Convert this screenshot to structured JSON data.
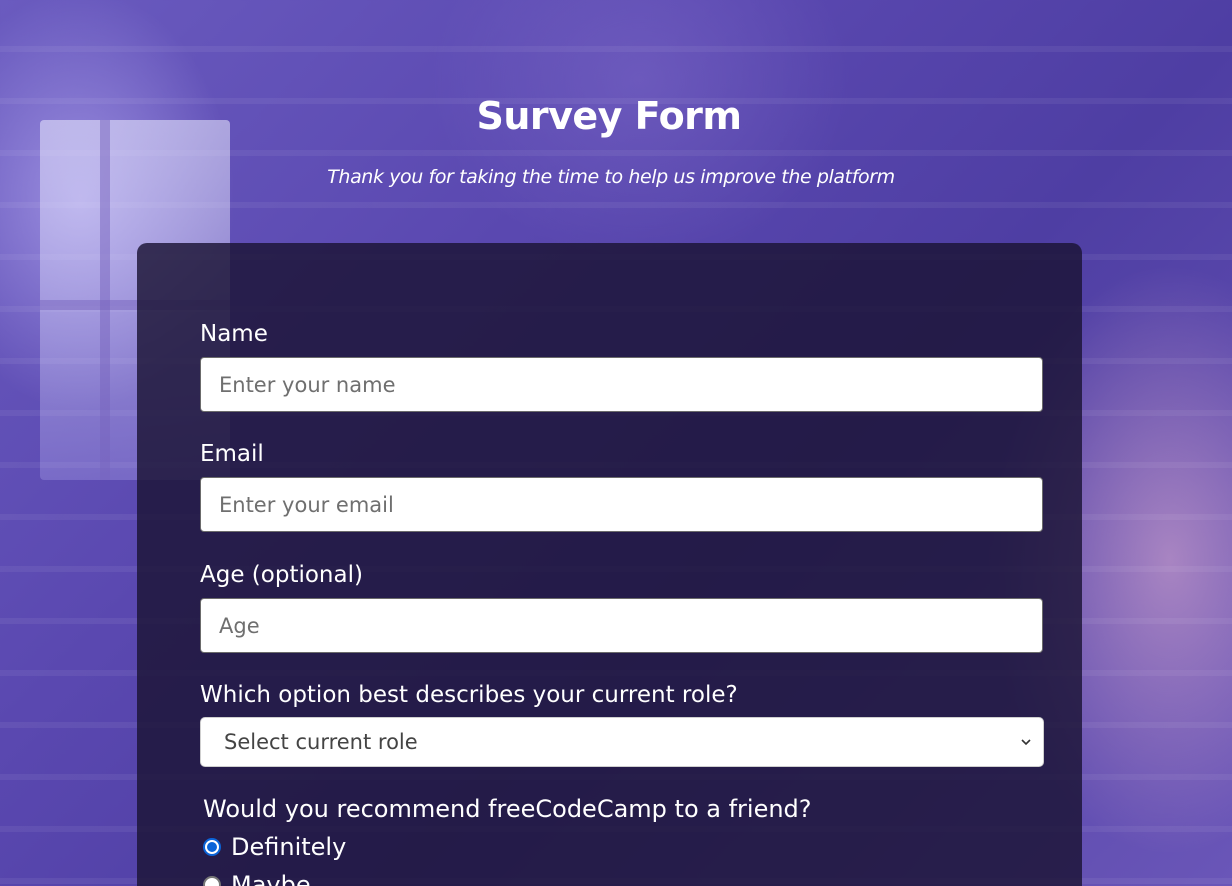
{
  "header": {
    "title": "Survey Form",
    "subtitle": "Thank you for taking the time to help us improve the platform"
  },
  "form": {
    "name": {
      "label": "Name",
      "value": "",
      "placeholder": "Enter your name"
    },
    "email": {
      "label": "Email",
      "value": "",
      "placeholder": "Enter your email"
    },
    "age": {
      "label": "Age (optional)",
      "value": "",
      "placeholder": "Age"
    },
    "role": {
      "label": "Which option best describes your current role?",
      "selected": "Select current role",
      "icon": "chevron-down-icon"
    },
    "recommend": {
      "label": "Would you recommend freeCodeCamp to a friend?",
      "options": [
        {
          "label": "Definitely",
          "checked": true
        },
        {
          "label": "Maybe",
          "checked": false
        }
      ]
    }
  },
  "colors": {
    "card_background": "#1b1434",
    "radio_accent": "#0b64d8",
    "background_tint": "#5a48b0"
  }
}
